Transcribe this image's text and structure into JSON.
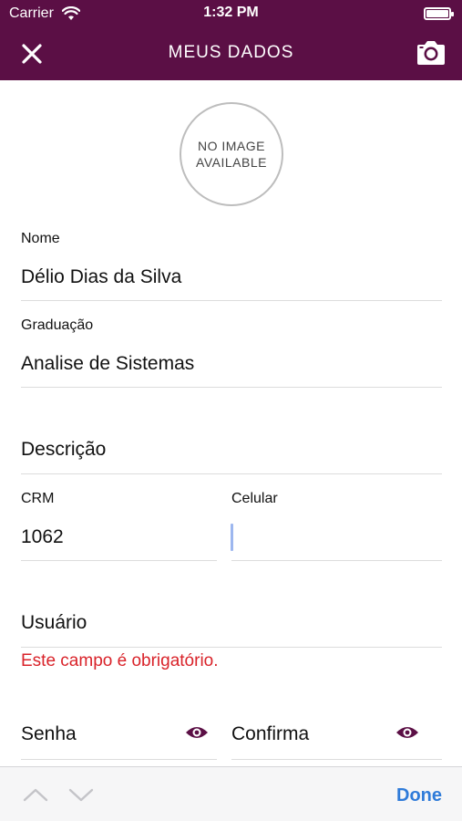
{
  "status_bar": {
    "carrier": "Carrier",
    "time": "1:32 PM"
  },
  "nav": {
    "title": "MEUS DADOS",
    "close_icon": "close-icon",
    "camera_icon": "camera-icon"
  },
  "avatar": {
    "line1": "NO IMAGE",
    "line2": "AVAILABLE"
  },
  "form": {
    "nome_label": "Nome",
    "nome_value": "Délio Dias da Silva",
    "graduacao_label": "Graduação",
    "graduacao_value": "Analise de Sistemas",
    "descricao_placeholder": "Descrição",
    "crm_label": "CRM",
    "crm_value": "1062",
    "celular_label": "Celular",
    "usuario_placeholder": "Usuário",
    "usuario_error": "Este campo é obrigatório.",
    "senha_placeholder": "Senha",
    "confirma_placeholder": "Confirma"
  },
  "keyboard_toolbar": {
    "done_label": "Done"
  },
  "colors": {
    "header": "#5b0f45",
    "error": "#d9232a",
    "accent": "#2f7bd9"
  }
}
